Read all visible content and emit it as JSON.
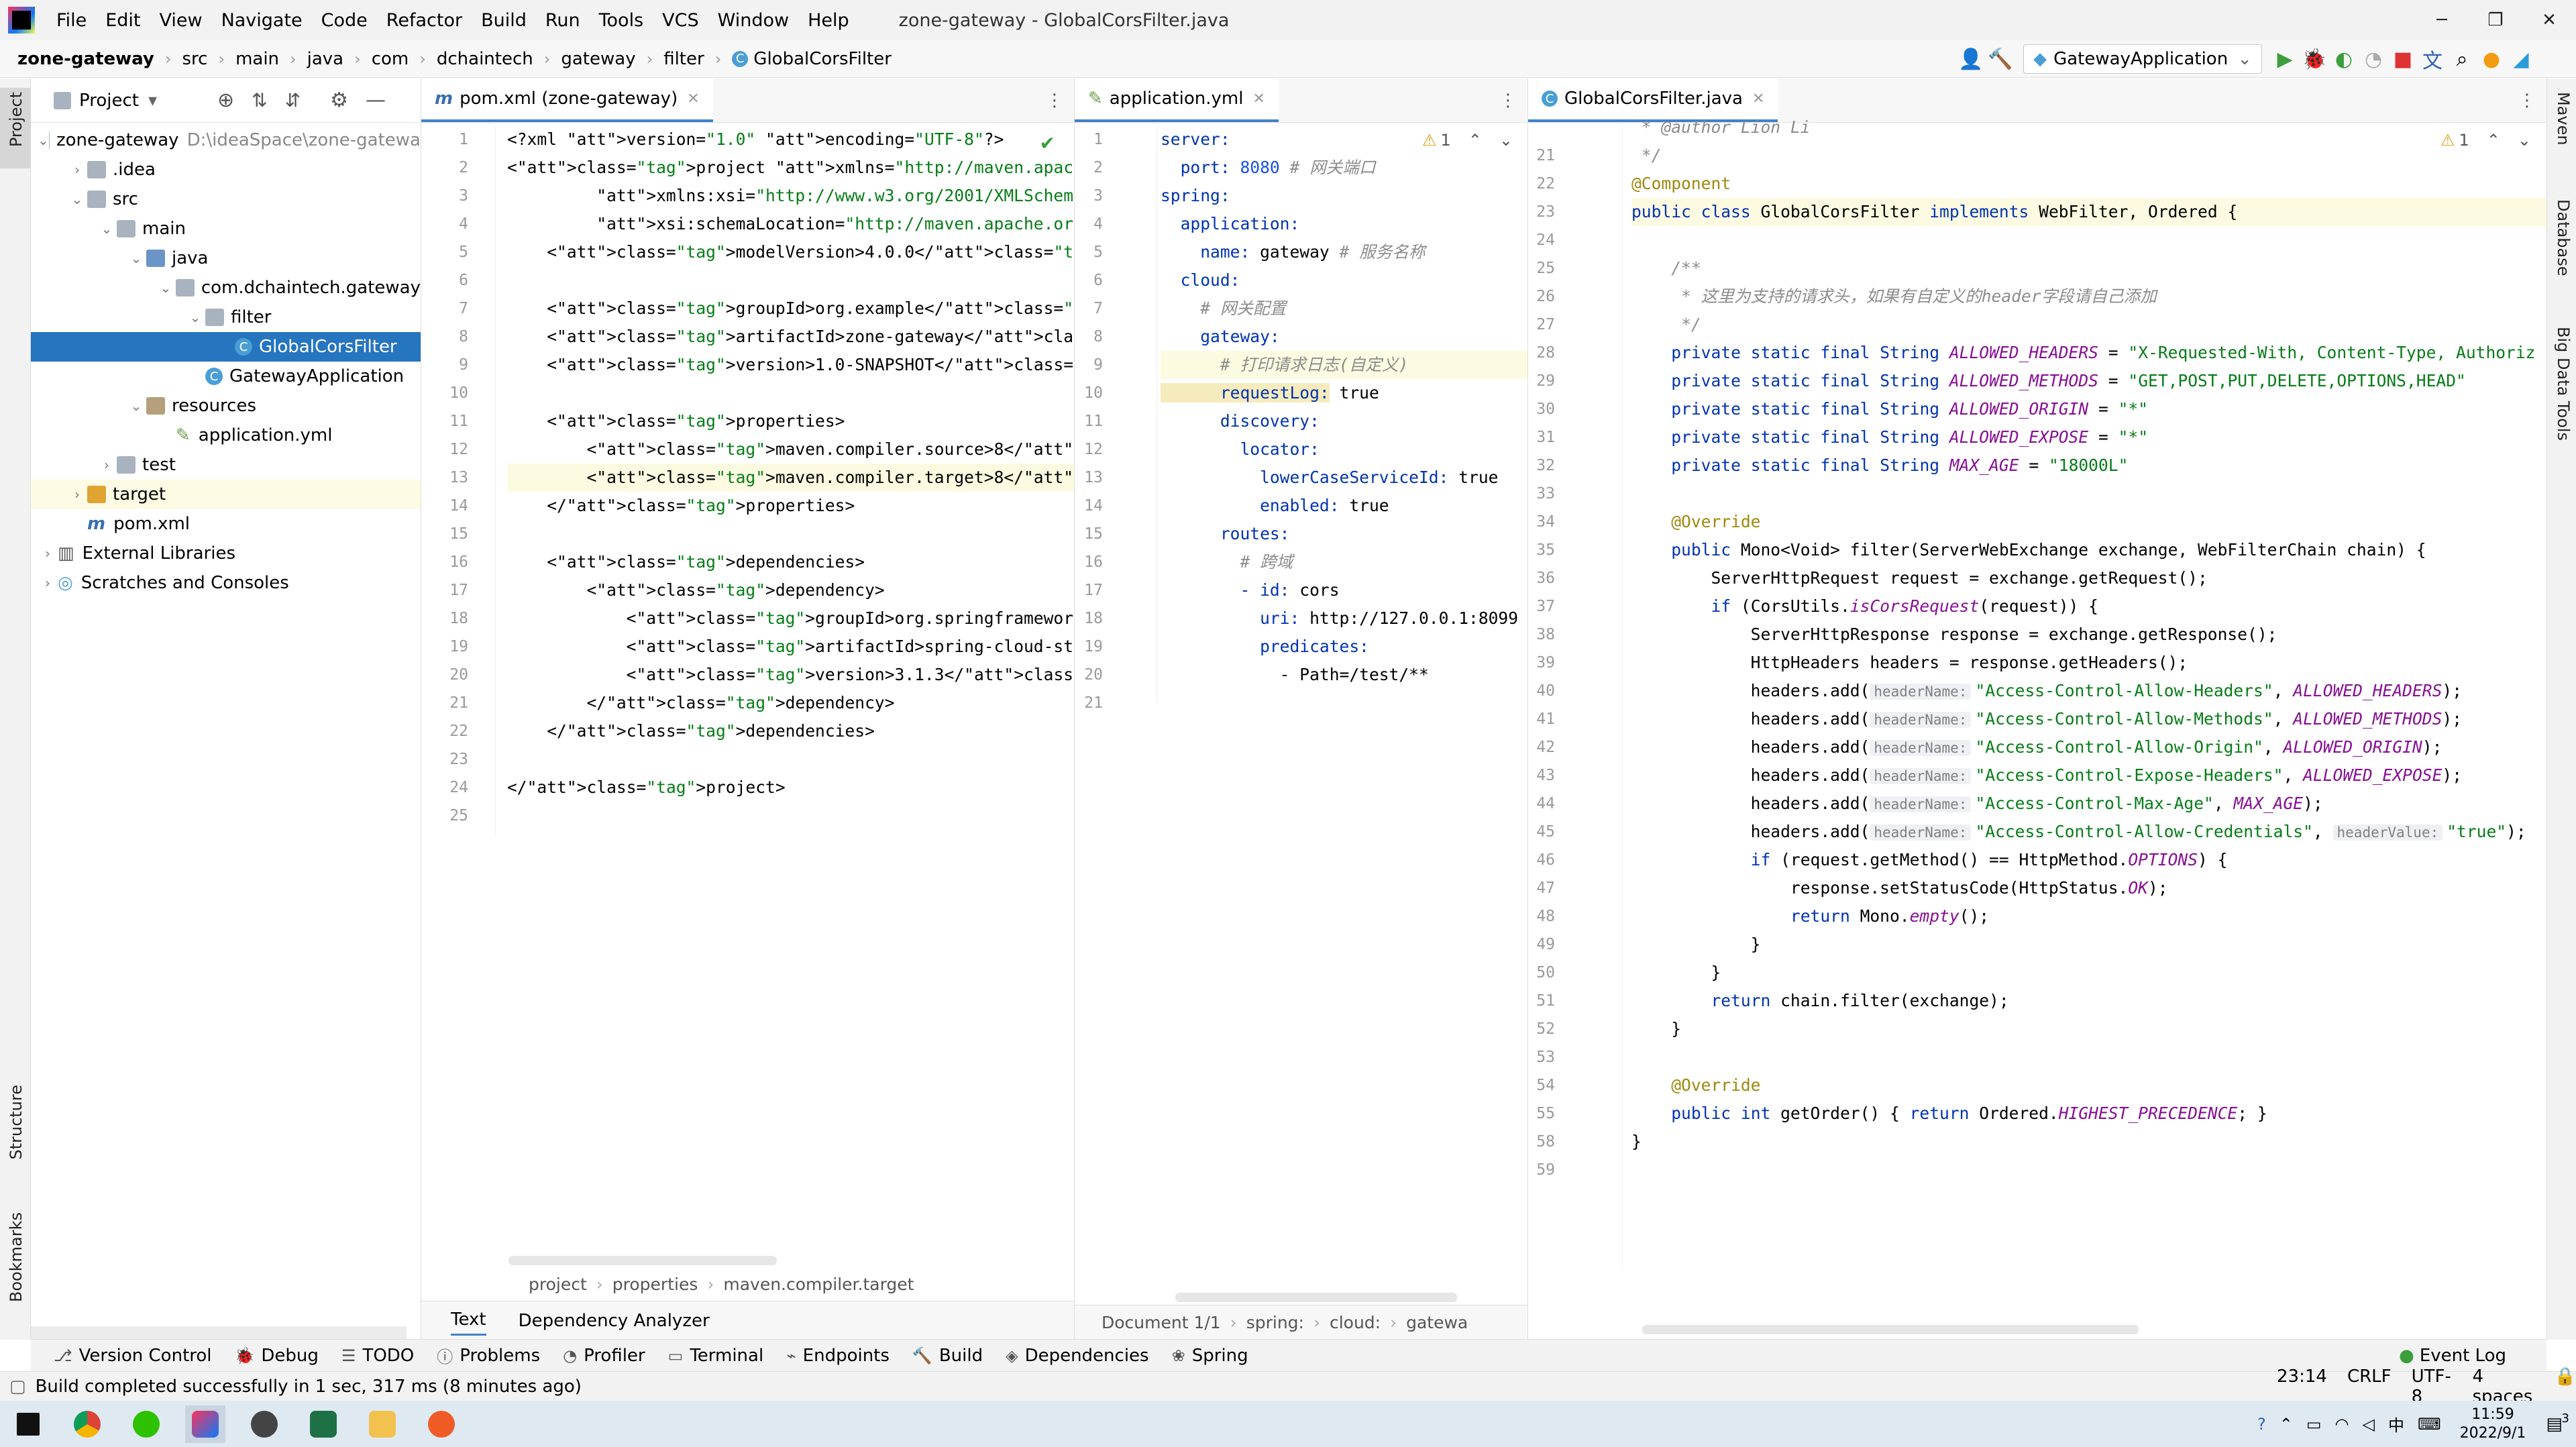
{
  "menu": {
    "items": [
      "File",
      "Edit",
      "View",
      "Navigate",
      "Code",
      "Refactor",
      "Build",
      "Run",
      "Tools",
      "VCS",
      "Window",
      "Help"
    ],
    "window_title": "zone-gateway - GlobalCorsFilter.java"
  },
  "window_controls": {
    "minimize": "─",
    "maximize": "❐",
    "close": "✕"
  },
  "breadcrumb": [
    "zone-gateway",
    "src",
    "main",
    "java",
    "com",
    "dchaintech",
    "gateway",
    "filter",
    "GlobalCorsFilter"
  ],
  "toolbar": {
    "run_config": "GatewayApplication"
  },
  "left_stripe": {
    "project": "Project",
    "structure": "Structure",
    "bookmarks": "Bookmarks"
  },
  "right_stripe": {
    "maven": "Maven",
    "database": "Database",
    "big_data": "Big Data Tools"
  },
  "project_panel": {
    "title": "Project",
    "tree": [
      {
        "label": "zone-gateway",
        "extra": "D:\\ideaSpace\\zone-gatewa",
        "indent": 0,
        "arrow": "⌄",
        "icon": "folder"
      },
      {
        "label": ".idea",
        "extra": "",
        "indent": 1,
        "arrow": "›",
        "icon": "folder"
      },
      {
        "label": "src",
        "extra": "",
        "indent": 1,
        "arrow": "⌄",
        "icon": "folder"
      },
      {
        "label": "main",
        "extra": "",
        "indent": 2,
        "arrow": "⌄",
        "icon": "folder"
      },
      {
        "label": "java",
        "extra": "",
        "indent": 3,
        "arrow": "⌄",
        "icon": "src"
      },
      {
        "label": "com.dchaintech.gateway",
        "extra": "",
        "indent": 4,
        "arrow": "⌄",
        "icon": "folder"
      },
      {
        "label": "filter",
        "extra": "",
        "indent": 5,
        "arrow": "⌄",
        "icon": "folder"
      },
      {
        "label": "GlobalCorsFilter",
        "extra": "",
        "indent": 6,
        "arrow": "",
        "icon": "class"
      },
      {
        "label": "GatewayApplication",
        "extra": "",
        "indent": 5,
        "arrow": "",
        "icon": "class"
      },
      {
        "label": "resources",
        "extra": "",
        "indent": 3,
        "arrow": "⌄",
        "icon": "res"
      },
      {
        "label": "application.yml",
        "extra": "",
        "indent": 4,
        "arrow": "",
        "icon": "yml"
      },
      {
        "label": "test",
        "extra": "",
        "indent": 2,
        "arrow": "›",
        "icon": "folder"
      },
      {
        "label": "target",
        "extra": "",
        "indent": 1,
        "arrow": "›",
        "icon": "tgt"
      },
      {
        "label": "pom.xml",
        "extra": "",
        "indent": 1,
        "arrow": "",
        "icon": "maven"
      },
      {
        "label": "External Libraries",
        "extra": "",
        "indent": 0,
        "arrow": "›",
        "icon": "lib"
      },
      {
        "label": "Scratches and Consoles",
        "extra": "",
        "indent": 0,
        "arrow": "›",
        "icon": "scratch"
      }
    ]
  },
  "pom_editor": {
    "tab": "pom.xml (zone-gateway)",
    "lines": [
      "<?xml version=\"1.0\" encoding=\"UTF-8\"?>",
      "<project xmlns=\"http://maven.apache.org/POM/4.0.0\"",
      "         xmlns:xsi=\"http://www.w3.org/2001/XMLSchema-ins",
      "         xsi:schemaLocation=\"http://maven.apache.org/POM",
      "    <modelVersion>4.0.0</modelVersion>",
      "",
      "    <groupId>org.example</groupId>",
      "    <artifactId>zone-gateway</artifactId>",
      "    <version>1.0-SNAPSHOT</version>",
      "",
      "    <properties>",
      "        <maven.compiler.source>8</maven.compiler.source>",
      "        <maven.compiler.target>8</maven.compiler.target>",
      "    </properties>",
      "",
      "    <dependencies>",
      "        <dependency>",
      "            <groupId>org.springframework.cloud</groupId>",
      "            <artifactId>spring-cloud-starter-gateway</ar",
      "            <version>3.1.3</version>",
      "        </dependency>",
      "    </dependencies>",
      "",
      "</project>",
      ""
    ],
    "breadcrumb": [
      "project",
      "properties",
      "maven.compiler.target"
    ],
    "bottom_tabs": [
      "Text",
      "Dependency Analyzer"
    ]
  },
  "yml_editor": {
    "tab": "application.yml",
    "warning_count": "1",
    "lines": [
      {
        "k": "server:",
        "v": "",
        "c": ""
      },
      {
        "k": "  port:",
        "v": " 8080",
        "c": " # 网关端口"
      },
      {
        "k": "spring:",
        "v": "",
        "c": ""
      },
      {
        "k": "  application:",
        "v": "",
        "c": ""
      },
      {
        "k": "    name:",
        "v": " gateway",
        "c": " # 服务名称"
      },
      {
        "k": "  cloud:",
        "v": "",
        "c": ""
      },
      {
        "k": "",
        "v": "",
        "c": "    # 网关配置"
      },
      {
        "k": "    gateway:",
        "v": "",
        "c": ""
      },
      {
        "k": "",
        "v": "",
        "c": "      # 打印请求日志(自定义)"
      },
      {
        "k": "      requestLog:",
        "v": " true",
        "c": ""
      },
      {
        "k": "      discovery:",
        "v": "",
        "c": ""
      },
      {
        "k": "        locator:",
        "v": "",
        "c": ""
      },
      {
        "k": "          lowerCaseServiceId:",
        "v": " true",
        "c": ""
      },
      {
        "k": "          enabled:",
        "v": " true",
        "c": ""
      },
      {
        "k": "      routes:",
        "v": "",
        "c": ""
      },
      {
        "k": "",
        "v": "",
        "c": "        # 跨域"
      },
      {
        "k": "        - id:",
        "v": " cors",
        "c": ""
      },
      {
        "k": "          uri:",
        "v": " http://127.0.0.1:8099",
        "c": ""
      },
      {
        "k": "          predicates:",
        "v": "",
        "c": ""
      },
      {
        "k": "",
        "v": "            - Path=/test/**",
        "c": ""
      },
      {
        "k": "",
        "v": "",
        "c": ""
      }
    ],
    "breadcrumb": [
      "Document 1/1",
      "spring:",
      "cloud:",
      "gatewa"
    ]
  },
  "java_editor": {
    "tab": "GlobalCorsFilter.java",
    "warning_count": "1",
    "line_numbers": [
      "",
      "21",
      "22",
      "23",
      "24",
      "25",
      "26",
      "27",
      "28",
      "29",
      "30",
      "31",
      "32",
      "33",
      "34",
      "35",
      "36",
      "37",
      "38",
      "39",
      "40",
      "41",
      "42",
      "43",
      "44",
      "45",
      "46",
      "47",
      "48",
      "49",
      "50",
      "51",
      "52",
      "53",
      "54",
      "55",
      "58",
      "59"
    ],
    "author_line": " * @author Lion Li",
    "lines": {
      "l21": " */",
      "l22": "@Component",
      "l23a": "public class ",
      "l23b": "GlobalCorsFilter",
      "l23c": " implements WebFilter, Ordered {",
      "l25": "    /**",
      "l26": "     * 这里为支持的请求头，如果有自定义的header字段请自己添加",
      "l27": "     */",
      "l28a": "    private static final String ",
      "l28b": "ALLOWED_HEADERS",
      "l28c": " = ",
      "l28d": "\"X-Requested-With, Content-Type, Authoriz",
      "l29b": "ALLOWED_METHODS",
      "l29d": "\"GET,POST,PUT,DELETE,OPTIONS,HEAD\"",
      "l30b": "ALLOWED_ORIGIN",
      "l30d": "\"*\"",
      "l31b": "ALLOWED_EXPOSE",
      "l31d": "\"*\"",
      "l32b": "MAX_AGE",
      "l32d": "\"18000L\"",
      "l34": "    @Override",
      "l35": "    public Mono<Void> filter(ServerWebExchange exchange, WebFilterChain chain) {",
      "l36": "        ServerHttpRequest request = exchange.getRequest();",
      "l37a": "        if (CorsUtils.",
      "l37b": "isCorsRequest",
      "l37c": "(request)) {",
      "l38": "            ServerHttpResponse response = exchange.getResponse();",
      "l39": "            HttpHeaders headers = response.getHeaders();",
      "hint_name": "headerName:",
      "hint_value": "headerValue:",
      "add_prefix": "            headers.add(",
      "h40s": "\"Access-Control-Allow-Headers\"",
      "h40c": "ALLOWED_HEADERS",
      "h41s": "\"Access-Control-Allow-Methods\"",
      "h41c": "ALLOWED_METHODS",
      "h42s": "\"Access-Control-Allow-Origin\"",
      "h42c": "ALLOWED_ORIGIN",
      "h43s": "\"Access-Control-Expose-Headers\"",
      "h43c": "ALLOWED_EXPOSE",
      "h44s": "\"Access-Control-Max-Age\"",
      "h44c": "MAX_AGE",
      "h45s": "\"Access-Control-Allow-Credentials\"",
      "h45v": "\"true\"",
      "l46a": "            if (request.getMethod() == HttpMethod.",
      "l46b": "OPTIONS",
      "l46c": ") {",
      "l47a": "                response.setStatusCode(HttpStatus.",
      "l47b": "OK",
      "l47c": ");",
      "l48a": "                return Mono.",
      "l48b": "empty",
      "l48c": "();",
      "l49": "            }",
      "l50": "        }",
      "l51": "        return chain.filter(exchange);",
      "l52": "    }",
      "l54": "    @Override",
      "l55a": "    public int getOrder() { return Ordered.",
      "l55b": "HIGHEST_PRECEDENCE",
      "l55c": "; }",
      "l58": "}"
    }
  },
  "bottom_tools": [
    "Version Control",
    "Debug",
    "TODO",
    "Problems",
    "Profiler",
    "Terminal",
    "Endpoints",
    "Build",
    "Dependencies",
    "Spring"
  ],
  "event_log": "Event Log",
  "status": {
    "message": "Build completed successfully in 1 sec, 317 ms (8 minutes ago)",
    "position": "23:14",
    "line_sep": "CRLF",
    "encoding": "UTF-8",
    "indent": "4 spaces"
  },
  "taskbar": {
    "time": "11:59",
    "date": "2022/9/1",
    "ime": "中",
    "notification_count": "3"
  }
}
